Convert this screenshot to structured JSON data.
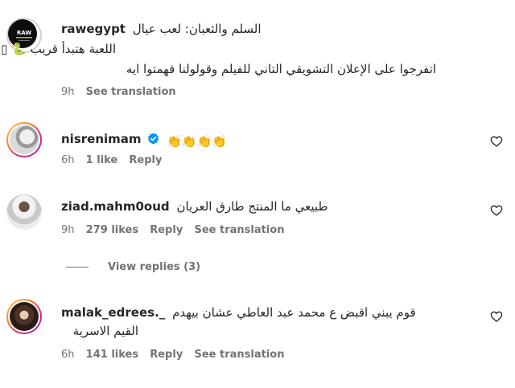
{
  "comments": [
    {
      "username": "rawegypt",
      "text_line1": "السلم والثعبان: لعب عيال",
      "text_line2": "اللعبة هتبدأ قريب 🐍 ▯",
      "text_line3": "اتفرجوا على الإعلان التشويقي التاني للفيلم وقولولنا فهمتوا ايه",
      "time": "9h",
      "likes": "",
      "reply_label": "",
      "translation_label": "See translation",
      "avatar_text": "RAW"
    },
    {
      "username": "nisrenimam",
      "text_line1": "👏👏👏👏",
      "time": "6h",
      "likes": "1 like",
      "reply_label": "Reply",
      "translation_label": ""
    },
    {
      "username": "ziad.mahm0oud",
      "text_line1": "طبيعي ما المنتج طارق العريان",
      "time": "9h",
      "likes": "279 likes",
      "reply_label": "Reply",
      "translation_label": "See translation",
      "view_replies": "View replies (3)"
    },
    {
      "username": "malak_edrees._",
      "text_line1": "قوم يبني اقبض ع محمد عبد العاطي عشان بيهدم",
      "text_line2": "القيم الاسرية",
      "time": "6h",
      "likes": "141 likes",
      "reply_label": "Reply",
      "translation_label": "See translation"
    }
  ],
  "icons": {
    "heart": "heart-outline-icon",
    "verified": "verified-badge-icon"
  },
  "colors": {
    "text": "#262626",
    "muted": "#737373",
    "verified": "#0095f6"
  }
}
